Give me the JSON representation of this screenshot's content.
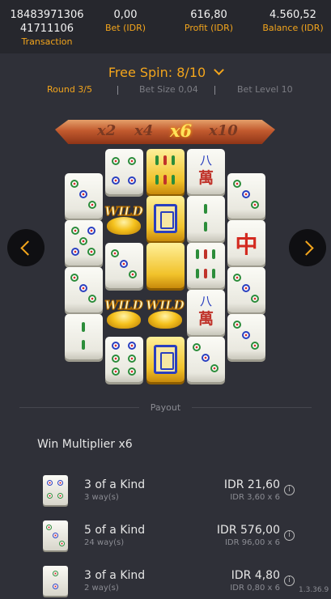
{
  "header": {
    "transaction_id_line1": "18483971306",
    "transaction_id_line2": "41711106",
    "transaction_label": "Transaction",
    "bet_value": "0,00",
    "bet_label": "Bet (IDR)",
    "profit_value": "616,80",
    "profit_label": "Profit (IDR)",
    "balance_value": "4.560,52",
    "balance_label": "Balance (IDR)"
  },
  "spin": {
    "title": "Free Spin: 8/10",
    "round": "Round 3/5",
    "bet_size": "Bet Size 0,04",
    "bet_level": "Bet Level 10"
  },
  "multipliers": [
    "x2",
    "x4",
    "x6",
    "x10"
  ],
  "wild_label": "WILD",
  "payout": {
    "section_label": "Payout",
    "win_multiplier": "Win Multiplier x6",
    "rows": [
      {
        "name": "3 of a Kind",
        "ways": "3 way(s)",
        "amount": "IDR 21,60",
        "calc": "IDR 3,60 x 6"
      },
      {
        "name": "5 of a Kind",
        "ways": "24 way(s)",
        "amount": "IDR 576,00",
        "calc": "IDR 96,00 x 6"
      },
      {
        "name": "3 of a Kind",
        "ways": "2 way(s)",
        "amount": "IDR 4,80",
        "calc": "IDR 0,80 x 6"
      }
    ]
  },
  "version": "1.3.36.9",
  "colors": {
    "accent": "#f3a51c",
    "background": "#2f3038",
    "header": "#26272d"
  }
}
